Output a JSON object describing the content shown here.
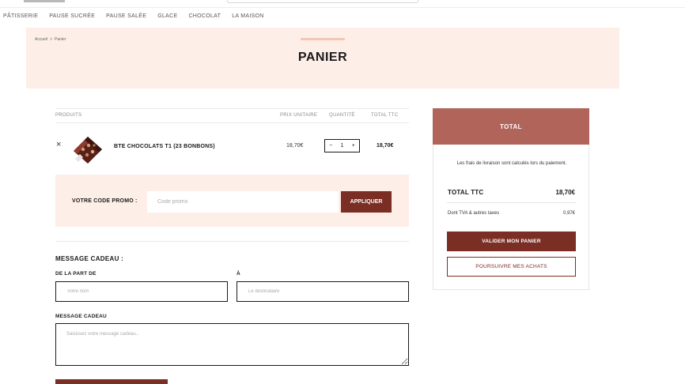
{
  "nav": {
    "items": [
      "PÂTISSERIE",
      "PAUSE SUCRÉE",
      "PAUSE SALÉE",
      "GLACE",
      "CHOCOLAT",
      "LA MAISON"
    ]
  },
  "breadcrumb": {
    "home": "Accueil",
    "separator": ">",
    "current": "Panier"
  },
  "page_title": "PANIER",
  "cart": {
    "columns": {
      "products": "PRODUITS",
      "unit_price": "PRIX UNITAIRE",
      "quantity": "QUANTITÉ",
      "total": "TOTAL TTC"
    },
    "item": {
      "remove": "×",
      "name": "BTE CHOCOLATS T1 (23 BONBONS)",
      "unit_price": "18,70€",
      "qty_minus": "−",
      "qty_value": "1",
      "qty_plus": "+",
      "total": "18,70€"
    }
  },
  "promo": {
    "label": "VOTRE CODE PROMO :",
    "placeholder": "Code promo",
    "button": "APPLIQUER"
  },
  "gift": {
    "title": "MESSAGE CADEAU :",
    "from_label": "DE LA PART DE",
    "from_placeholder": "Votre nom",
    "to_label": "À",
    "to_placeholder": "Le destinataire",
    "message_label": "MESSAGE CADEAU",
    "message_placeholder": "Saisissez votre message cadeau..."
  },
  "summary": {
    "title": "TOTAL",
    "note": "Les frais de livraison sont calculés lors du paiement.",
    "total_label": "TOTAL TTC",
    "total_value": "18,70€",
    "tax_label": "Dont TVA & autres taxes",
    "tax_value": "0,97€",
    "validate_button": "VALIDER MON PANIER",
    "continue_button": "POURSUIVRE MES ACHATS"
  },
  "colors": {
    "accent_dark": "#7b2e24",
    "summary_header": "#b0645a",
    "hero_bg": "#fdeee8"
  }
}
